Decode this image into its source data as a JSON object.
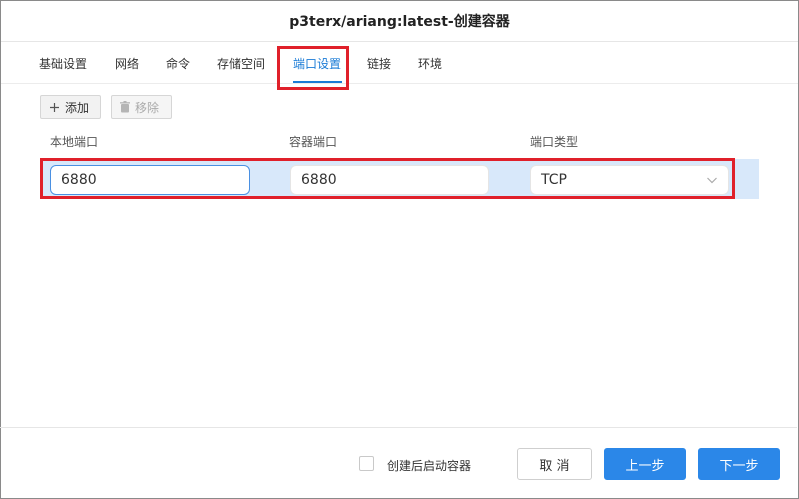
{
  "dialog": {
    "title": "p3terx/ariang:latest-创建容器"
  },
  "tabs": [
    {
      "label": "基础设置"
    },
    {
      "label": "网络"
    },
    {
      "label": "命令"
    },
    {
      "label": "存储空间"
    },
    {
      "label": "端口设置",
      "active": true
    },
    {
      "label": "链接"
    },
    {
      "label": "环境"
    }
  ],
  "toolbar": {
    "add_label": "添加",
    "remove_label": "移除"
  },
  "table": {
    "columns": [
      "本地端口",
      "容器端口",
      "端口类型"
    ],
    "rows": [
      {
        "local_port": "6880",
        "container_port": "6880",
        "type": "TCP"
      }
    ]
  },
  "footer": {
    "start_after_create_label": "创建后启动容器",
    "start_after_create_checked": false,
    "cancel_label": "取 消",
    "prev_label": "上一步",
    "next_label": "下一步"
  },
  "colors": {
    "accent": "#2b87e8",
    "active_tab": "#1a7bd6",
    "highlight": "#e0202a",
    "row_bg": "#d8e8fa"
  }
}
